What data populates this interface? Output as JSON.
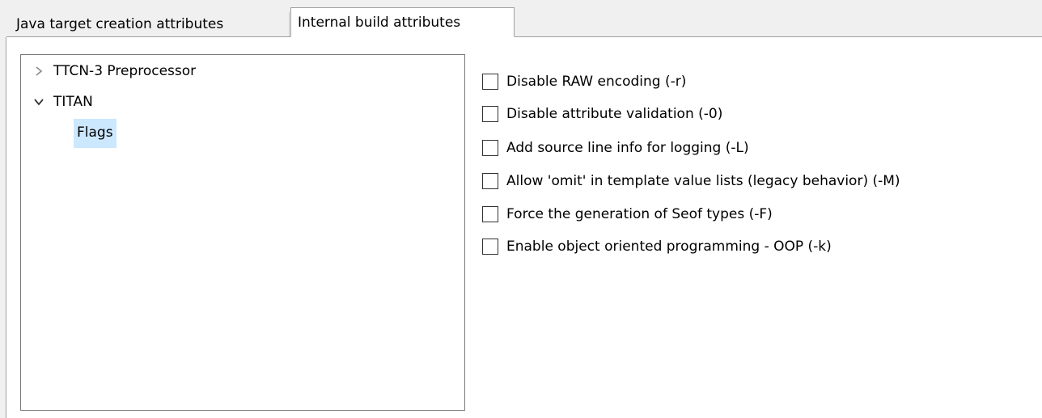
{
  "tabs": [
    {
      "label": "Java target creation attributes",
      "active": false
    },
    {
      "label": "Internal build attributes",
      "active": true
    }
  ],
  "tree": {
    "items": [
      {
        "label": "TTCN-3 Preprocessor",
        "expanded": false
      },
      {
        "label": "TITAN",
        "expanded": true
      },
      {
        "label": "Flags",
        "selected": true
      }
    ]
  },
  "options": [
    {
      "label": "Disable RAW encoding (-r)",
      "checked": false
    },
    {
      "label": "Disable attribute validation (-0)",
      "checked": false
    },
    {
      "label": "Add source line info for logging (-L)",
      "checked": false
    },
    {
      "label": "Allow 'omit' in template value lists (legacy behavior) (-M)",
      "checked": false
    },
    {
      "label": "Force the generation of Seof types (-F)",
      "checked": false
    },
    {
      "label": "Enable object oriented programming - OOP (-k)",
      "checked": false
    }
  ],
  "colors": {
    "selection": "#cce8ff",
    "tab_strip": "#f0f0f0",
    "border": "#a0a0a0"
  }
}
